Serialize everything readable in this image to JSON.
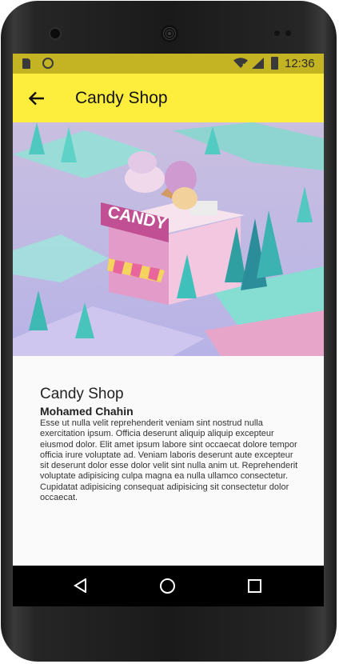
{
  "status_bar": {
    "time": "12:36",
    "icons": [
      "sd-card-icon",
      "sync-circle-icon",
      "wifi-icon",
      "signal-icon",
      "battery-icon"
    ],
    "color": "#c4b424"
  },
  "app_bar": {
    "title": "Candy Shop",
    "back_icon": "arrow-left-icon",
    "color": "#fded3c"
  },
  "hero": {
    "sign_text": "CANDY"
  },
  "details": {
    "title": "Candy Shop",
    "author": "Mohamed Chahin",
    "description": "Esse ut nulla velit reprehenderit veniam sint nostrud nulla exercitation ipsum. Officia deserunt aliquip aliquip excepteur eiusmod dolor. Elit amet ipsum labore sint occaecat dolore tempor officia irure voluptate ad. Veniam laboris deserunt aute excepteur sit deserunt dolor esse dolor velit sint nulla anim ut. Reprehenderit voluptate adipisicing culpa magna ea nulla ullamco consectetur. Cupidatat adipisicing consequat adipisicing sit consectetur dolor occaecat."
  },
  "nav_bar": {
    "icons": [
      "nav-back-icon",
      "nav-home-icon",
      "nav-recents-icon"
    ]
  }
}
